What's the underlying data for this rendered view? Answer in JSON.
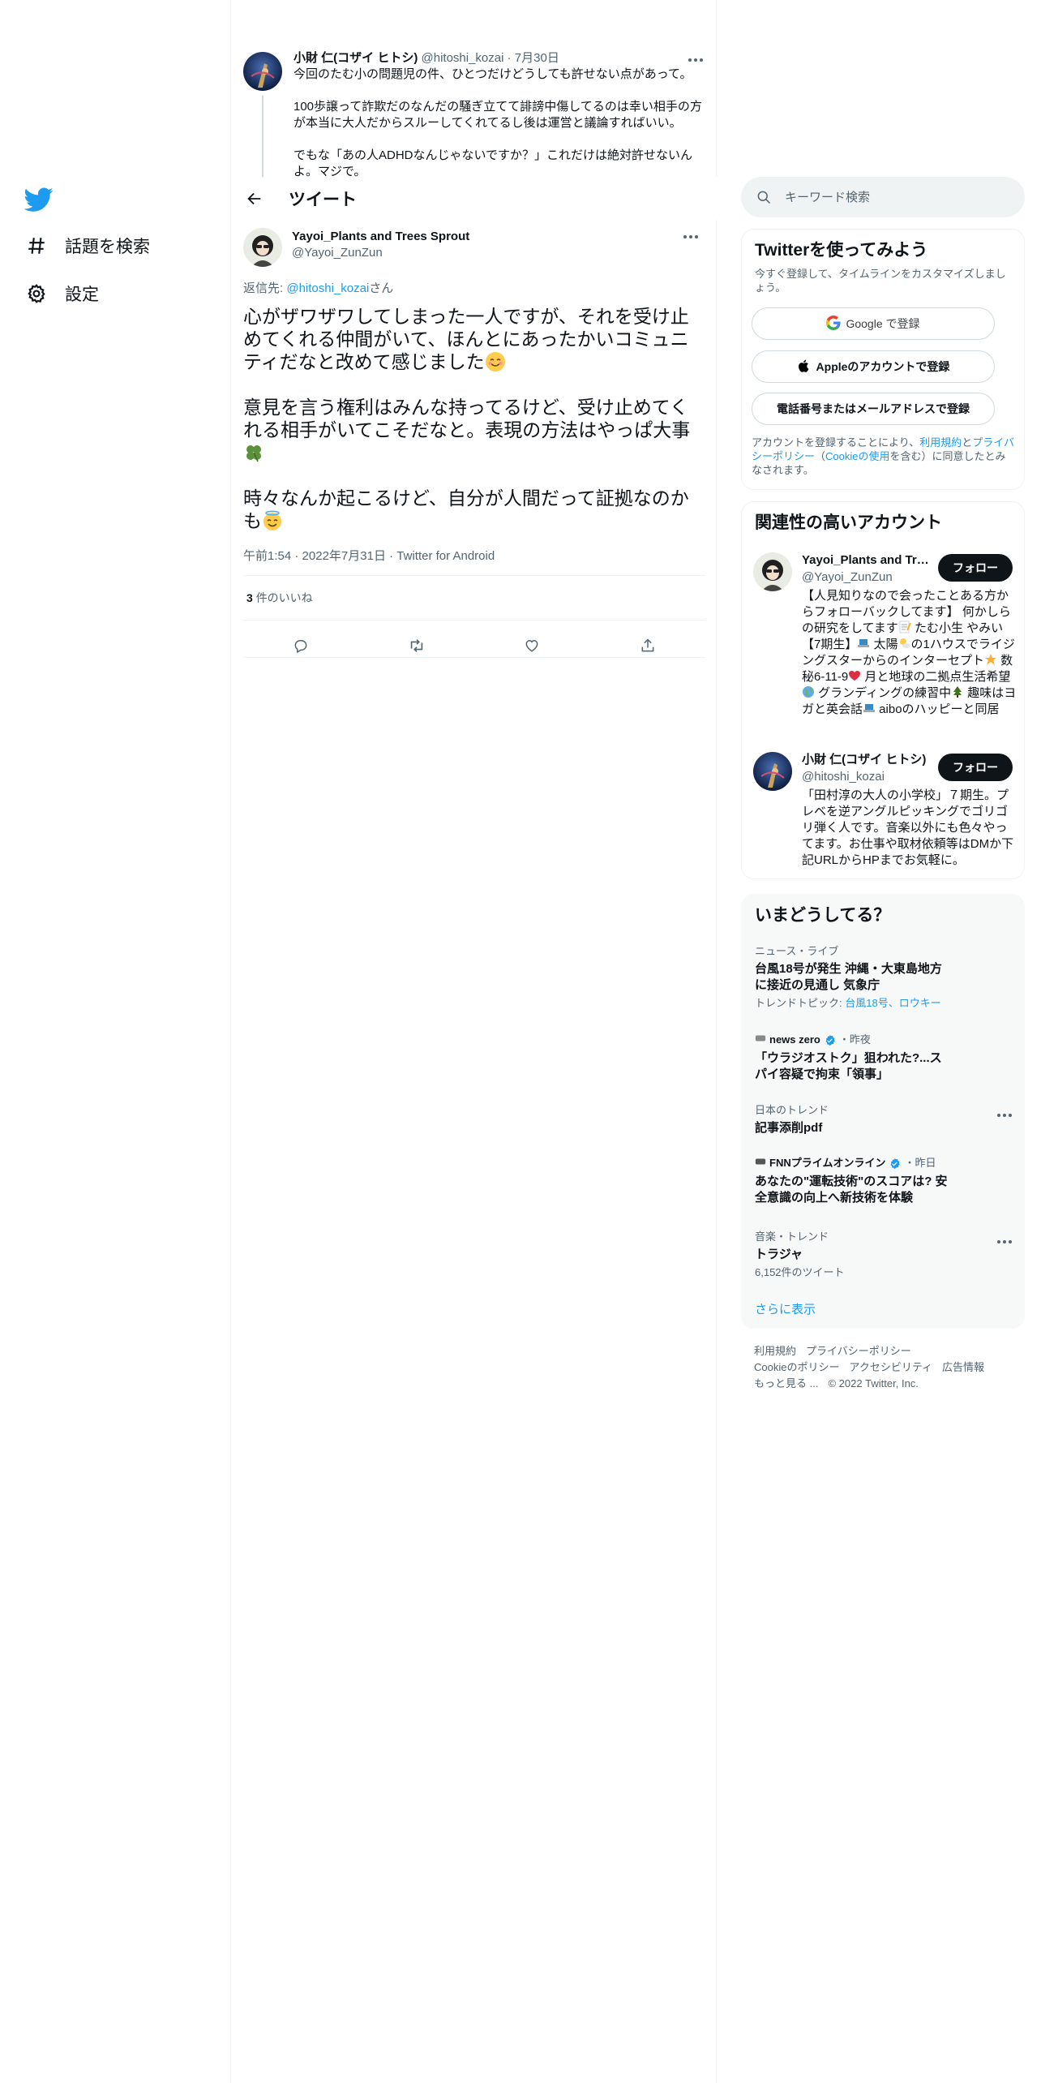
{
  "nav": {
    "explore_label": "話題を検索",
    "settings_label": "設定"
  },
  "parent_tweet": {
    "name": "小財 仁(コザイ ヒトシ)",
    "handle": "@hitoshi_kozai",
    "date": "7月30日",
    "p1": "今回のたむ小の問題児の件、ひとつだけどうしても許せない点があって。",
    "p2": "100歩譲って詐欺だのなんだの騒ぎ立てて誹謗中傷してるのは幸い相手の方が本当に大人だからスルーしてくれてるし後は運営と議論すればいい。",
    "p3": "でもな「あの人ADHDなんじゃないですか？」これだけは絶対許せないんよ。マジで。"
  },
  "header": {
    "title": "ツイート"
  },
  "main_tweet": {
    "name": "Yayoi_Plants and Trees Sprout",
    "handle": "@Yayoi_ZunZun",
    "reply_prefix": "返信先: ",
    "reply_handle": "@hitoshi_kozai",
    "reply_suffix": "さん",
    "p1": "心がザワザワしてしまった一人ですが、それを受け止めてくれる仲間がいて、ほんとにあったかいコミュニティだなと改めて感じました",
    "p2": "意見を言う権利はみんな持ってるけど、受け止めてくれる相手がいてこそだなと。表現の方法はやっぱ大事",
    "p3": "時々なんか起こるけど、自分が人間だって証拠なのかも",
    "time": "午前1:54",
    "date": "2022年7月31日",
    "source": "Twitter for Android",
    "likes_count": "3",
    "likes_label": "件のいいね"
  },
  "search": {
    "placeholder": "キーワード検索"
  },
  "signup": {
    "title": "Twitterを使ってみよう",
    "subtitle": "今すぐ登録して、タイムラインをカスタマイズしましょう。",
    "google_label": "Google で登録",
    "apple_label": "Appleのアカウントで登録",
    "phone_label": "電話番号またはメールアドレスで登録",
    "legal_1": "アカウントを登録することにより、",
    "legal_terms": "利用規約",
    "legal_2": "と",
    "legal_privacy": "プライバシーポリシー",
    "legal_3": "（",
    "legal_cookie": "Cookieの使用",
    "legal_4": "を含む）に同意したとみなされます。"
  },
  "relevant": {
    "title": "関連性の高いアカウント",
    "follow_label": "フォロー",
    "accounts": [
      {
        "name": "Yayoi_Plants and Trees Sprout",
        "handle": "@Yayoi_ZunZun",
        "bio_1": "【人見知りなので会ったことある方からフォローバックしてます】 何かしらの研究をしてます",
        "bio_2": " たむ小生 やみい【7期生】",
        "bio_3": " 太陽",
        "bio_4": "の1ハウスでライジングスターからのインターセプト",
        "bio_5": " 数秘6-11-9",
        "bio_6": " 月と地球の二拠点生活希望",
        "bio_7": " グランディングの練習中",
        "bio_8": " 趣味はヨガと英会話",
        "bio_9": " aiboのハッピーと同居"
      },
      {
        "name": "小財 仁(コザイ ヒトシ)",
        "handle": "@hitoshi_kozai",
        "bio": "「田村淳の大人の小学校」７期生。プレベを逆アングルピッキングでゴリゴリ弾く人です。音楽以外にも色々やってます。お仕事や取材依頼等はDMか下記URLからHPまでお気軽に。"
      }
    ]
  },
  "trends": {
    "title": "いまどうしてる？",
    "items": [
      {
        "category": "ニュース・ライブ",
        "title": "台風18号が発生 沖縄・大東島地方に接近の見通し 気象庁",
        "topic_label": "トレンドトピック: ",
        "topic_links": "台風18号、ロウキー"
      },
      {
        "source": "news zero",
        "time": "・昨夜",
        "title": "「ウラジオストク」狙われた?...スパイ容疑で拘束「領事」"
      },
      {
        "category": "日本のトレンド",
        "title": "記事添削pdf"
      },
      {
        "source": "FNNプライムオンライン",
        "time": "・昨日",
        "title": "あなたの\"運転技術\"のスコアは? 安全意識の向上へ新技術を体験"
      },
      {
        "category": "音楽・トレンド",
        "title": "トラジャ",
        "count": "6,152件のツイート"
      }
    ],
    "show_more": "さらに表示"
  },
  "footer": {
    "terms": "利用規約",
    "privacy": "プライバシーポリシー",
    "cookie": "Cookieのポリシー",
    "accessibility": "アクセシビリティ",
    "ads": "広告情報",
    "more": "もっと見る ...",
    "copyright": "© 2022 Twitter, Inc."
  },
  "colors": {
    "accent": "#1d9bf0",
    "text": "#0f1419",
    "secondary": "#536471",
    "border": "#eff3f4",
    "follow_bg": "#0f1419"
  }
}
